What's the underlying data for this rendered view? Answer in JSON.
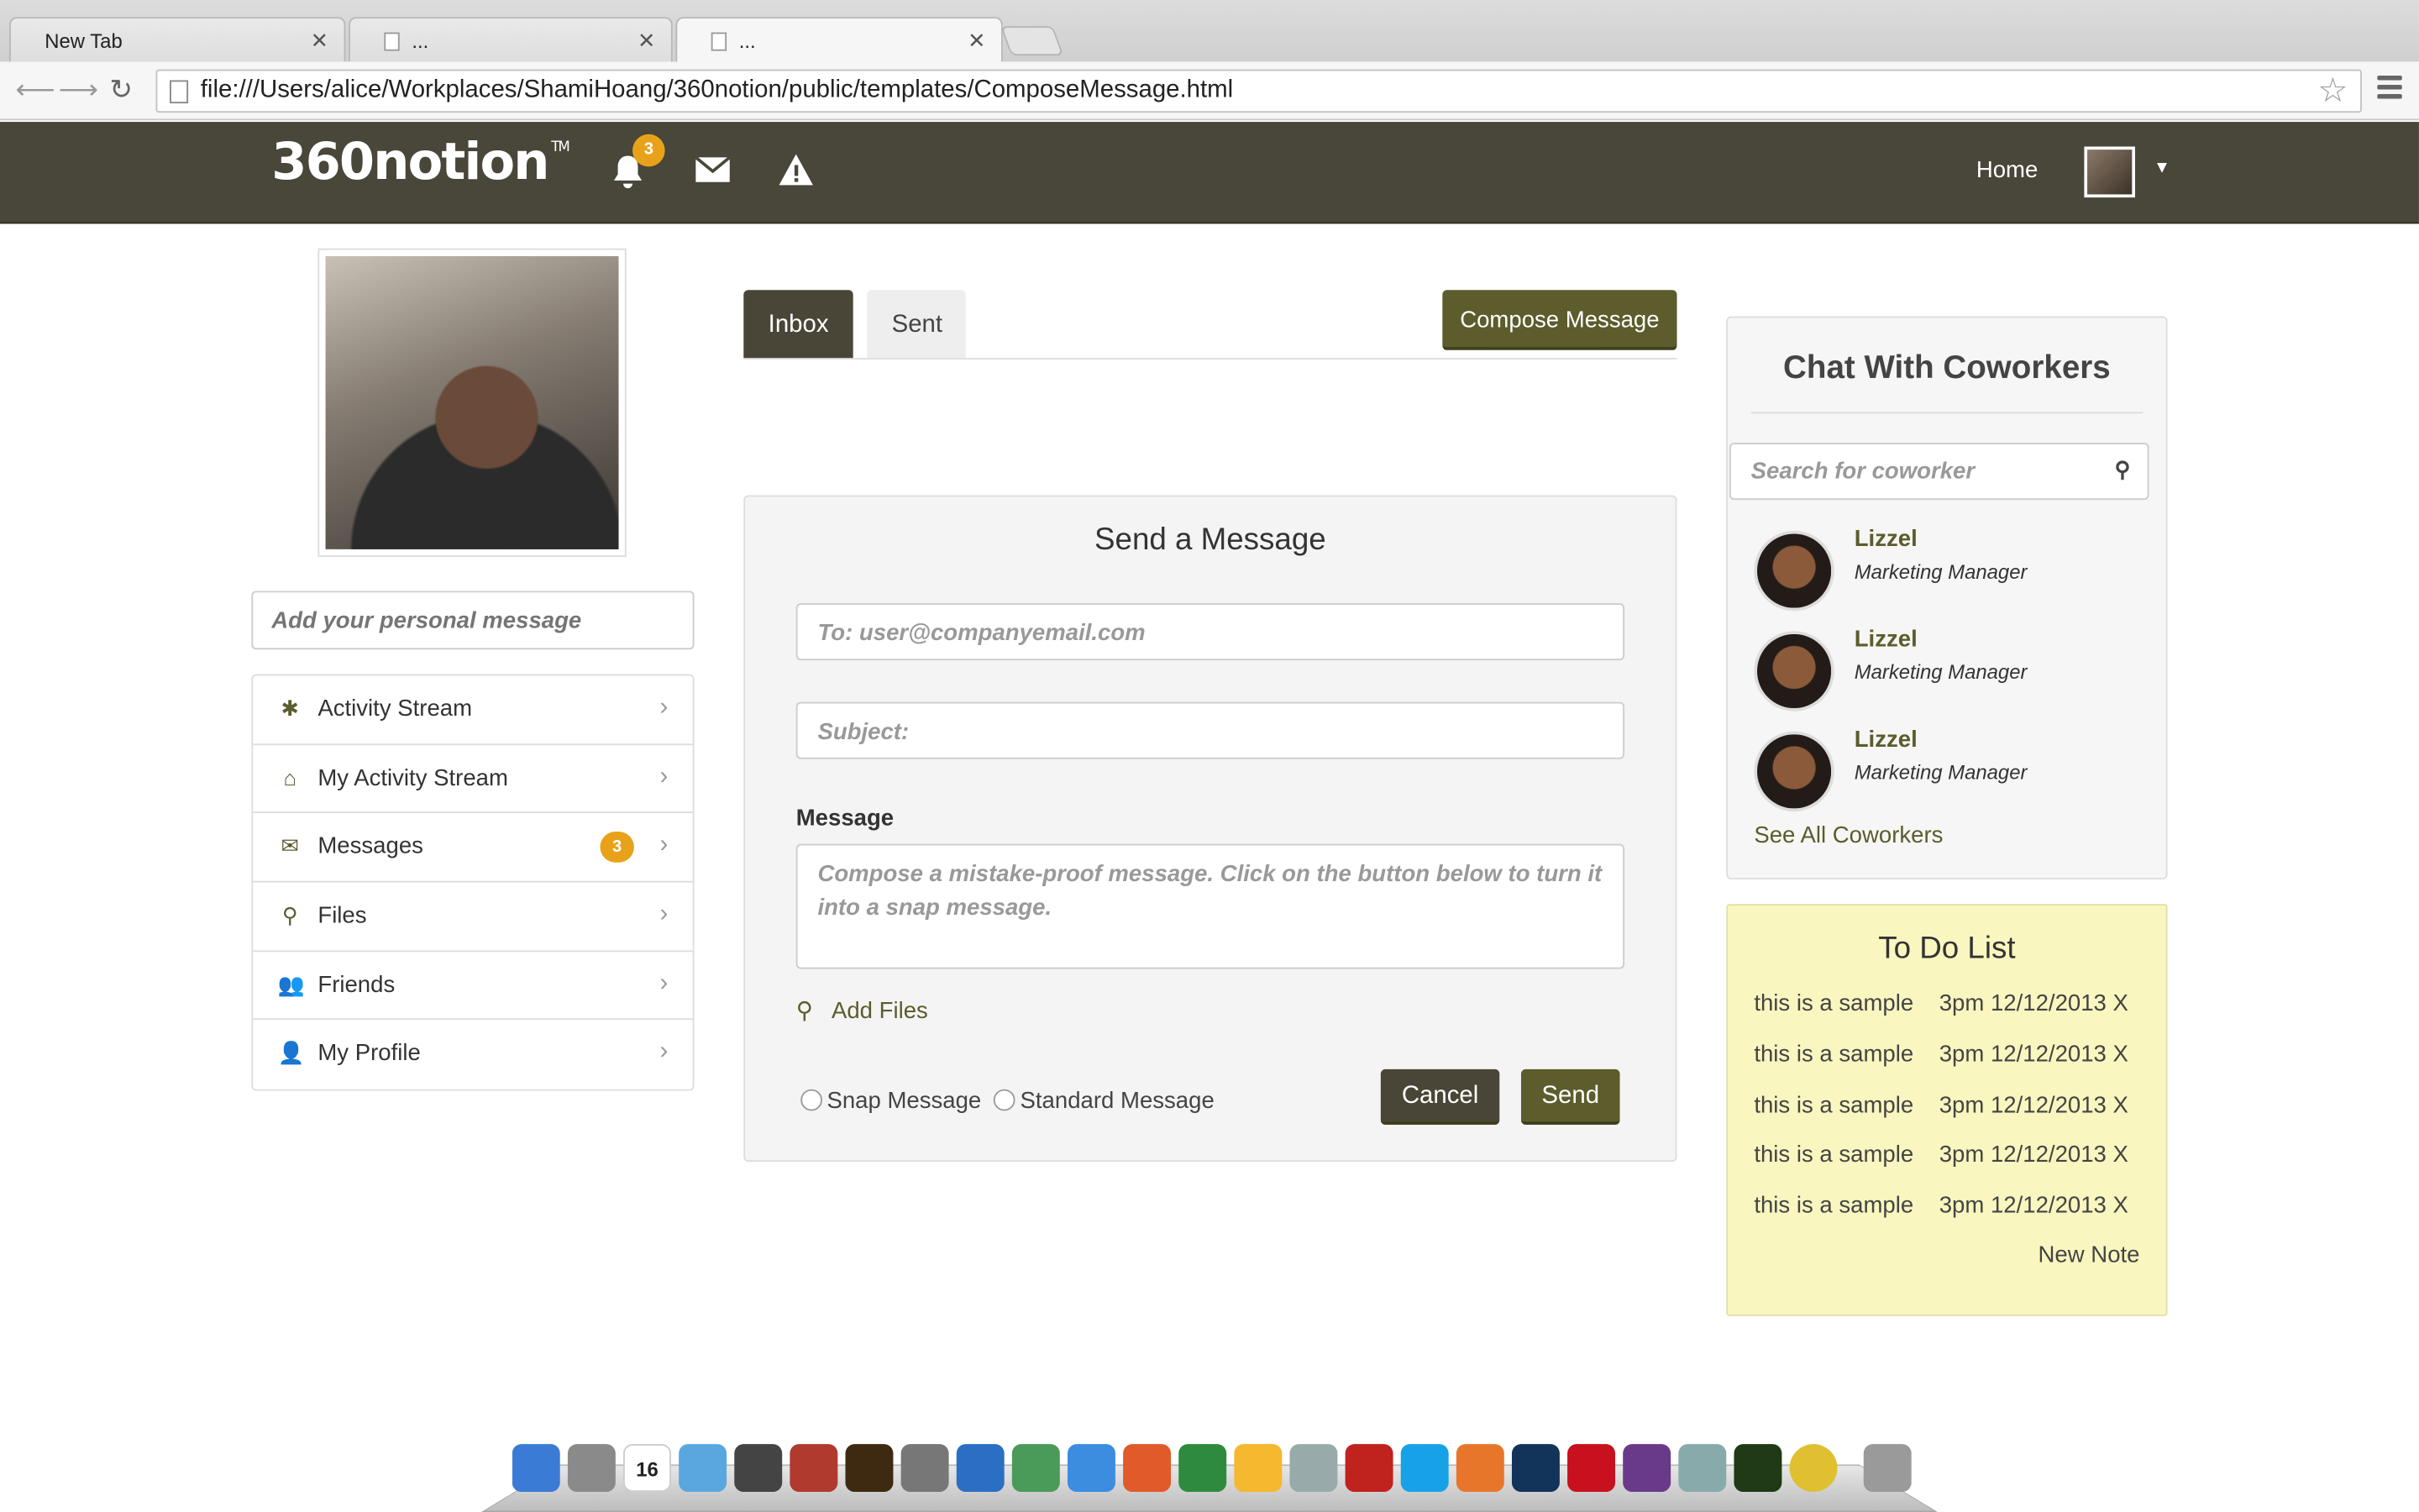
{
  "browser": {
    "tabs": [
      {
        "title": "New Tab",
        "active": false
      },
      {
        "title": "...",
        "active": false
      },
      {
        "title": "...",
        "active": true
      }
    ],
    "url": "file:///Users/alice/Workplaces/ShamiHoang/360notion/public/templates/ComposeMessage.html"
  },
  "navbar": {
    "logo_text": "360notion",
    "logo_tm": "TM",
    "notification_count": "3",
    "home_label": "Home"
  },
  "sidebar": {
    "personal_message_placeholder": "Add your personal message",
    "items": [
      {
        "label": "Activity Stream",
        "icon": "asterisk-icon"
      },
      {
        "label": "My Activity Stream",
        "icon": "home-icon"
      },
      {
        "label": "Messages",
        "icon": "envelope-icon",
        "badge": "3"
      },
      {
        "label": "Files",
        "icon": "paperclip-icon"
      },
      {
        "label": "Friends",
        "icon": "group-icon"
      },
      {
        "label": "My Profile",
        "icon": "user-icon"
      }
    ]
  },
  "mailbox": {
    "tabs": [
      {
        "label": "Inbox",
        "active": true
      },
      {
        "label": "Sent",
        "active": false
      }
    ],
    "compose_label": "Compose Message"
  },
  "compose": {
    "title": "Send a Message",
    "to_placeholder": "To: user@companyemail.com",
    "subject_placeholder": "Subject:",
    "message_label": "Message",
    "message_placeholder": "Compose a mistake-proof message. Click on the button below to turn it into a snap message.",
    "add_files_label": "Add Files",
    "radio_snap": "Snap Message",
    "radio_standard": "Standard Message",
    "cancel_label": "Cancel",
    "send_label": "Send"
  },
  "chat": {
    "title": "Chat With Coworkers",
    "search_placeholder": "Search for coworker",
    "coworkers": [
      {
        "name": "Lizzel",
        "role": "Marketing Manager"
      },
      {
        "name": "Lizzel",
        "role": "Marketing Manager"
      },
      {
        "name": "Lizzel",
        "role": "Marketing Manager"
      }
    ],
    "see_all_label": "See All Coworkers"
  },
  "todo": {
    "title": "To Do List",
    "items": [
      {
        "text": "this is a sample",
        "due": "3pm 12/12/2013 X"
      },
      {
        "text": "this is a sample",
        "due": "3pm 12/12/2013 X"
      },
      {
        "text": "this is a sample",
        "due": "3pm 12/12/2013 X"
      },
      {
        "text": "this is a sample",
        "due": "3pm 12/12/2013 X"
      },
      {
        "text": "this is a sample",
        "due": "3pm 12/12/2013 X"
      }
    ],
    "new_note_label": "New Note"
  },
  "dock": {
    "calendar_day": "16"
  },
  "colors": {
    "navbar_bg": "#49463a",
    "accent_olive": "#5c5c2c",
    "badge_orange": "#e8a21a",
    "todo_bg": "#f9f6bf"
  }
}
